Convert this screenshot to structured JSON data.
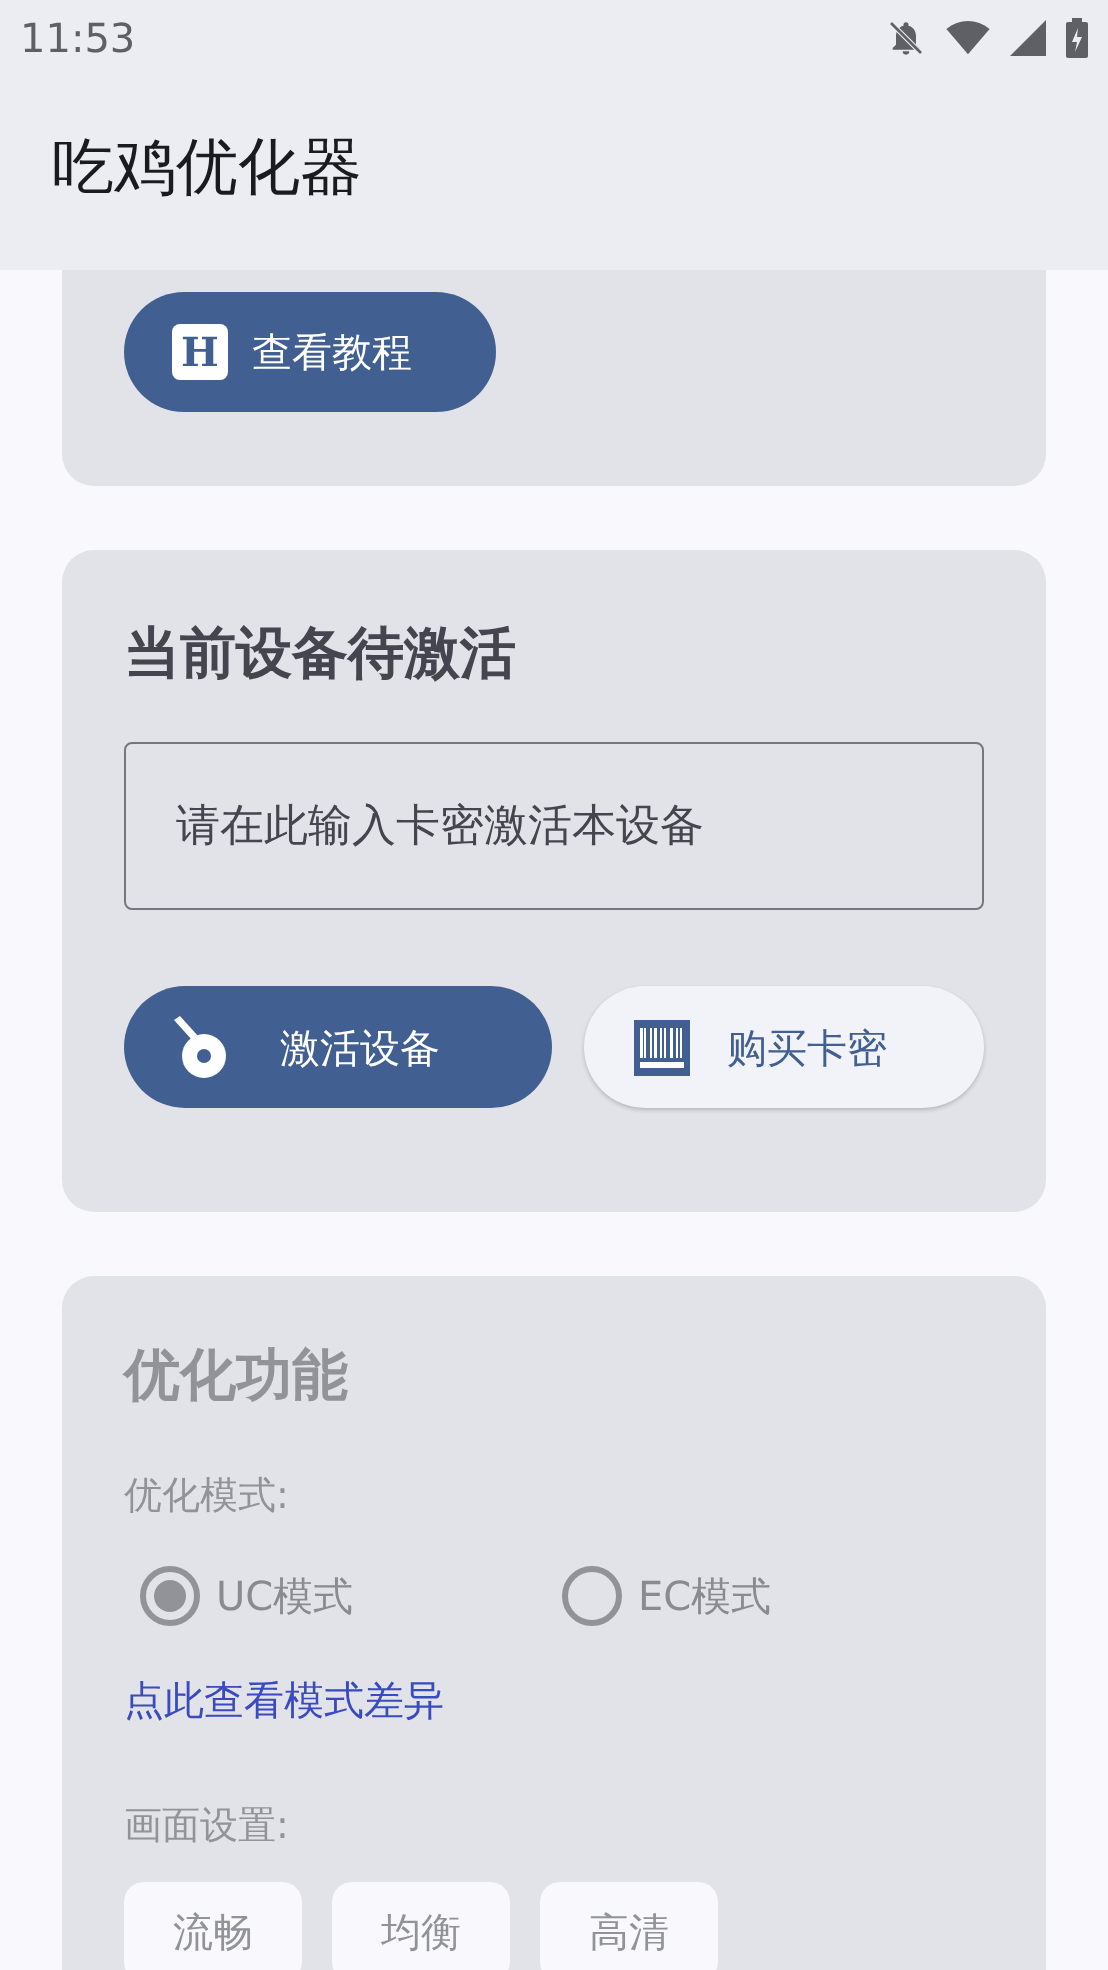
{
  "status_bar": {
    "time": "11:53"
  },
  "app_bar": {
    "title": "吃鸡优化器"
  },
  "tutorial_card": {
    "button": "查看教程",
    "button_icon_letter": "H"
  },
  "activation_card": {
    "title": "当前设备待激活",
    "input": {
      "placeholder": "请在此输入卡密激活本设备"
    },
    "buttons": [
      {
        "label": "激活设备",
        "kind": "primary"
      },
      {
        "label": "购买卡密",
        "kind": "secondary"
      }
    ]
  },
  "optimize_card": {
    "title": "优化功能",
    "mode_label": "优化模式:",
    "modes": [
      {
        "label": "UC模式",
        "selected": true
      },
      {
        "label": "EC模式",
        "selected": false
      }
    ],
    "link": "点此查看模式差异",
    "quality_label": "画面设置:",
    "quality_options": [
      {
        "label": "流畅"
      },
      {
        "label": "均衡"
      },
      {
        "label": "高清"
      }
    ]
  }
}
